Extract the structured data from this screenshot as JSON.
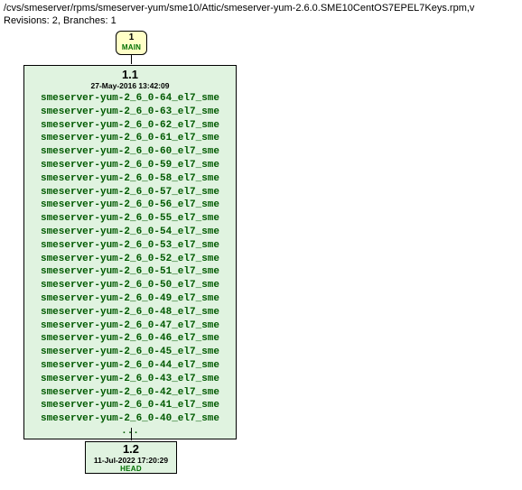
{
  "header": {
    "path": "/cvs/smeserver/rpms/smeserver-yum/sme10/Attic/smeserver-yum-2.6.0.SME10CentOS7EPEL7Keys.rpm,v",
    "meta": "Revisions: 2, Branches: 1"
  },
  "main_node": {
    "num": "1",
    "label": "MAIN"
  },
  "rev11": {
    "rev": "1.1",
    "date": "27-May-2016 13:42:09",
    "tags": [
      "smeserver-yum-2_6_0-64_el7_sme",
      "smeserver-yum-2_6_0-63_el7_sme",
      "smeserver-yum-2_6_0-62_el7_sme",
      "smeserver-yum-2_6_0-61_el7_sme",
      "smeserver-yum-2_6_0-60_el7_sme",
      "smeserver-yum-2_6_0-59_el7_sme",
      "smeserver-yum-2_6_0-58_el7_sme",
      "smeserver-yum-2_6_0-57_el7_sme",
      "smeserver-yum-2_6_0-56_el7_sme",
      "smeserver-yum-2_6_0-55_el7_sme",
      "smeserver-yum-2_6_0-54_el7_sme",
      "smeserver-yum-2_6_0-53_el7_sme",
      "smeserver-yum-2_6_0-52_el7_sme",
      "smeserver-yum-2_6_0-51_el7_sme",
      "smeserver-yum-2_6_0-50_el7_sme",
      "smeserver-yum-2_6_0-49_el7_sme",
      "smeserver-yum-2_6_0-48_el7_sme",
      "smeserver-yum-2_6_0-47_el7_sme",
      "smeserver-yum-2_6_0-46_el7_sme",
      "smeserver-yum-2_6_0-45_el7_sme",
      "smeserver-yum-2_6_0-44_el7_sme",
      "smeserver-yum-2_6_0-43_el7_sme",
      "smeserver-yum-2_6_0-42_el7_sme",
      "smeserver-yum-2_6_0-41_el7_sme",
      "smeserver-yum-2_6_0-40_el7_sme"
    ],
    "ellipsis": "..."
  },
  "rev12": {
    "rev": "1.2",
    "date": "11-Jul-2022 17:20:29",
    "head": "HEAD"
  }
}
